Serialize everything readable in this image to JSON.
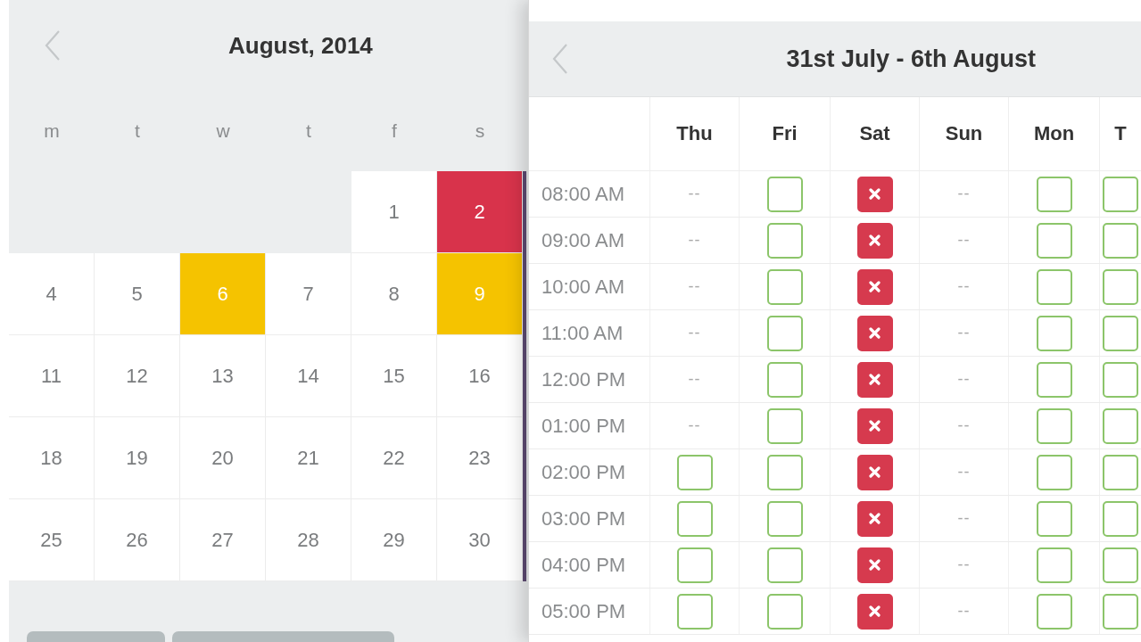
{
  "month_calendar": {
    "title": "August, 2014",
    "weekdays": [
      "m",
      "t",
      "w",
      "t",
      "f",
      "s"
    ],
    "weeks": [
      {
        "days": [
          {
            "kind": "blank"
          },
          {
            "kind": "blank"
          },
          {
            "kind": "blank"
          },
          {
            "kind": "blank"
          },
          {
            "kind": "day",
            "label": "1"
          },
          {
            "kind": "day",
            "label": "2",
            "color": "#d8334b"
          }
        ]
      },
      {
        "days": [
          {
            "kind": "day",
            "label": "4"
          },
          {
            "kind": "day",
            "label": "5"
          },
          {
            "kind": "day",
            "label": "6",
            "color": "#f5c300"
          },
          {
            "kind": "day",
            "label": "7"
          },
          {
            "kind": "day",
            "label": "8"
          },
          {
            "kind": "day",
            "label": "9",
            "color": "#f5c300"
          }
        ]
      },
      {
        "days": [
          {
            "kind": "day",
            "label": "11"
          },
          {
            "kind": "day",
            "label": "12"
          },
          {
            "kind": "day",
            "label": "13"
          },
          {
            "kind": "day",
            "label": "14"
          },
          {
            "kind": "day",
            "label": "15"
          },
          {
            "kind": "day",
            "label": "16"
          }
        ]
      },
      {
        "days": [
          {
            "kind": "day",
            "label": "18"
          },
          {
            "kind": "day",
            "label": "19"
          },
          {
            "kind": "day",
            "label": "20"
          },
          {
            "kind": "day",
            "label": "21"
          },
          {
            "kind": "day",
            "label": "22"
          },
          {
            "kind": "day",
            "label": "23"
          }
        ]
      },
      {
        "days": [
          {
            "kind": "day",
            "label": "25"
          },
          {
            "kind": "day",
            "label": "26"
          },
          {
            "kind": "day",
            "label": "27"
          },
          {
            "kind": "day",
            "label": "28"
          },
          {
            "kind": "day",
            "label": "29"
          },
          {
            "kind": "day",
            "label": "30"
          }
        ]
      }
    ]
  },
  "week_schedule": {
    "title": "31st July - 6th August",
    "columns": [
      "Thu",
      "Fri",
      "Sat",
      "Sun",
      "Mon",
      "T"
    ],
    "rows": [
      {
        "time": "08:00 AM",
        "cells": [
          {
            "kind": "text",
            "text": "--"
          },
          {
            "kind": "slot",
            "booked": false
          },
          {
            "kind": "slot",
            "booked": true
          },
          {
            "kind": "text",
            "text": "--"
          },
          {
            "kind": "slot",
            "booked": false
          },
          {
            "kind": "slot",
            "booked": false
          }
        ]
      },
      {
        "time": "09:00 AM",
        "cells": [
          {
            "kind": "text",
            "text": "--"
          },
          {
            "kind": "slot",
            "booked": false
          },
          {
            "kind": "slot",
            "booked": true
          },
          {
            "kind": "text",
            "text": "--"
          },
          {
            "kind": "slot",
            "booked": false
          },
          {
            "kind": "slot",
            "booked": false
          }
        ]
      },
      {
        "time": "10:00 AM",
        "cells": [
          {
            "kind": "text",
            "text": "--"
          },
          {
            "kind": "slot",
            "booked": false
          },
          {
            "kind": "slot",
            "booked": true
          },
          {
            "kind": "text",
            "text": "--"
          },
          {
            "kind": "slot",
            "booked": false
          },
          {
            "kind": "slot",
            "booked": false
          }
        ]
      },
      {
        "time": "11:00 AM",
        "cells": [
          {
            "kind": "text",
            "text": "--"
          },
          {
            "kind": "slot",
            "booked": false
          },
          {
            "kind": "slot",
            "booked": true
          },
          {
            "kind": "text",
            "text": "--"
          },
          {
            "kind": "slot",
            "booked": false
          },
          {
            "kind": "slot",
            "booked": false
          }
        ]
      },
      {
        "time": "12:00 PM",
        "cells": [
          {
            "kind": "text",
            "text": "--"
          },
          {
            "kind": "slot",
            "booked": false
          },
          {
            "kind": "slot",
            "booked": true
          },
          {
            "kind": "text",
            "text": "--"
          },
          {
            "kind": "slot",
            "booked": false
          },
          {
            "kind": "slot",
            "booked": false
          }
        ]
      },
      {
        "time": "01:00 PM",
        "cells": [
          {
            "kind": "text",
            "text": "--"
          },
          {
            "kind": "slot",
            "booked": false
          },
          {
            "kind": "slot",
            "booked": true
          },
          {
            "kind": "text",
            "text": "--"
          },
          {
            "kind": "slot",
            "booked": false
          },
          {
            "kind": "slot",
            "booked": false
          }
        ]
      },
      {
        "time": "02:00 PM",
        "cells": [
          {
            "kind": "slot",
            "booked": false
          },
          {
            "kind": "slot",
            "booked": false
          },
          {
            "kind": "slot",
            "booked": true
          },
          {
            "kind": "text",
            "text": "--"
          },
          {
            "kind": "slot",
            "booked": false
          },
          {
            "kind": "slot",
            "booked": false
          }
        ]
      },
      {
        "time": "03:00 PM",
        "cells": [
          {
            "kind": "slot",
            "booked": false
          },
          {
            "kind": "slot",
            "booked": false
          },
          {
            "kind": "slot",
            "booked": true
          },
          {
            "kind": "text",
            "text": "--"
          },
          {
            "kind": "slot",
            "booked": false
          },
          {
            "kind": "slot",
            "booked": false
          }
        ]
      },
      {
        "time": "04:00 PM",
        "cells": [
          {
            "kind": "slot",
            "booked": false
          },
          {
            "kind": "slot",
            "booked": false
          },
          {
            "kind": "slot",
            "booked": true
          },
          {
            "kind": "text",
            "text": "--"
          },
          {
            "kind": "slot",
            "booked": false
          },
          {
            "kind": "slot",
            "booked": false
          }
        ]
      },
      {
        "time": "05:00 PM",
        "cells": [
          {
            "kind": "slot",
            "booked": false
          },
          {
            "kind": "slot",
            "booked": false
          },
          {
            "kind": "slot",
            "booked": true
          },
          {
            "kind": "text",
            "text": "--"
          },
          {
            "kind": "slot",
            "booked": false
          },
          {
            "kind": "slot",
            "booked": false
          }
        ]
      }
    ]
  }
}
